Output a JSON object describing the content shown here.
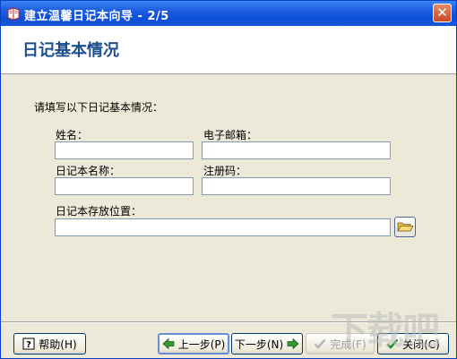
{
  "window": {
    "title": "建立温馨日记本向导 - 2/5"
  },
  "header": {
    "title": "日记基本情况"
  },
  "form": {
    "instruction": "请填写以下日记基本情况：",
    "name_label": "姓名：",
    "name_value": "",
    "email_label": "电子邮箱：",
    "email_value": "",
    "diary_name_label": "日记本名称：",
    "diary_name_value": "",
    "reg_code_label": "注册码：",
    "reg_code_value": "",
    "location_label": "日记本存放位置：",
    "location_value": ""
  },
  "buttons": {
    "help": "帮助(H)",
    "prev": "上一步(P)",
    "next": "下一步(N)",
    "finish": "完成(F)",
    "close": "关闭(C)"
  },
  "watermark": {
    "text": "下载吧"
  },
  "colors": {
    "title_bar": "#0c4ed8",
    "header_title": "#1d4f8c",
    "dialog_bg": "#ece9d8"
  }
}
